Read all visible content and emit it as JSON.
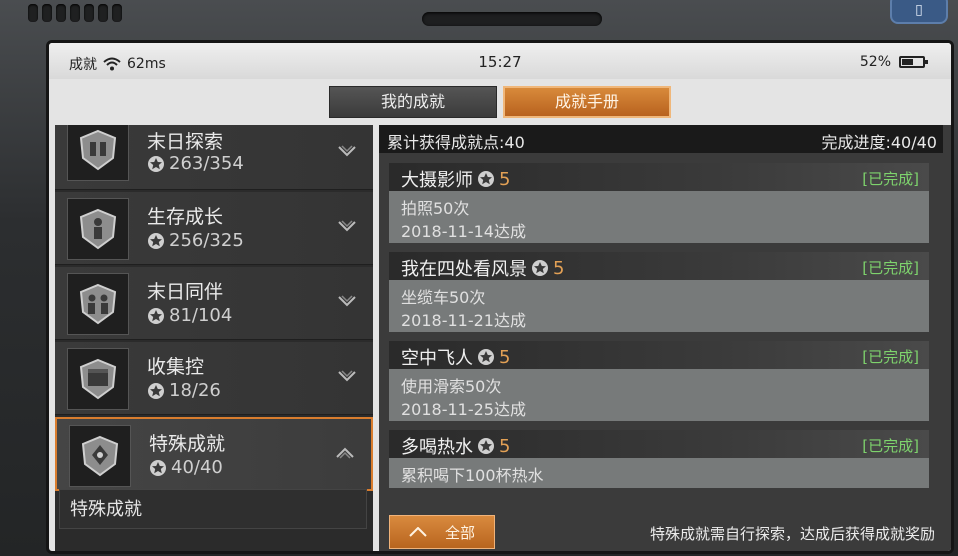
{
  "statusbar": {
    "carrier": "成就",
    "latency": "62ms",
    "time": "15:27",
    "battery": "52%",
    "battery_level": 0.52
  },
  "tabs": [
    {
      "label": "我的成就",
      "active": false
    },
    {
      "label": "成就手册",
      "active": true
    }
  ],
  "categories": [
    {
      "title": "末日探索",
      "progress": "263/354"
    },
    {
      "title": "生存成长",
      "progress": "256/325"
    },
    {
      "title": "末日同伴",
      "progress": "81/104"
    },
    {
      "title": "收集控",
      "progress": "18/26"
    },
    {
      "title": "特殊成就",
      "progress": "40/40"
    }
  ],
  "sub_item": "特殊成就",
  "summary": {
    "points_text": "累计获得成就点:40",
    "completion_text": "完成进度:40/40"
  },
  "achievements": [
    {
      "name": "大摄影师",
      "points": "5",
      "status": "[已完成]",
      "desc": "拍照50次",
      "date": "2018-11-14达成"
    },
    {
      "name": "我在四处看风景",
      "points": "5",
      "status": "[已完成]",
      "desc": "坐缆车50次",
      "date": "2018-11-21达成"
    },
    {
      "name": "空中飞人",
      "points": "5",
      "status": "[已完成]",
      "desc": "使用滑索50次",
      "date": "2018-11-25达成"
    },
    {
      "name": "多喝热水",
      "points": "5",
      "status": "[已完成]",
      "desc": "累积喝下100杯热水",
      "date": ""
    }
  ],
  "footer": {
    "filter_label": "全部",
    "note": "特殊成就需自行探索，达成后获得成就奖励"
  },
  "colors": {
    "accent": "#d97d2e",
    "completed": "#7ed36d",
    "points": "#e2a055"
  }
}
